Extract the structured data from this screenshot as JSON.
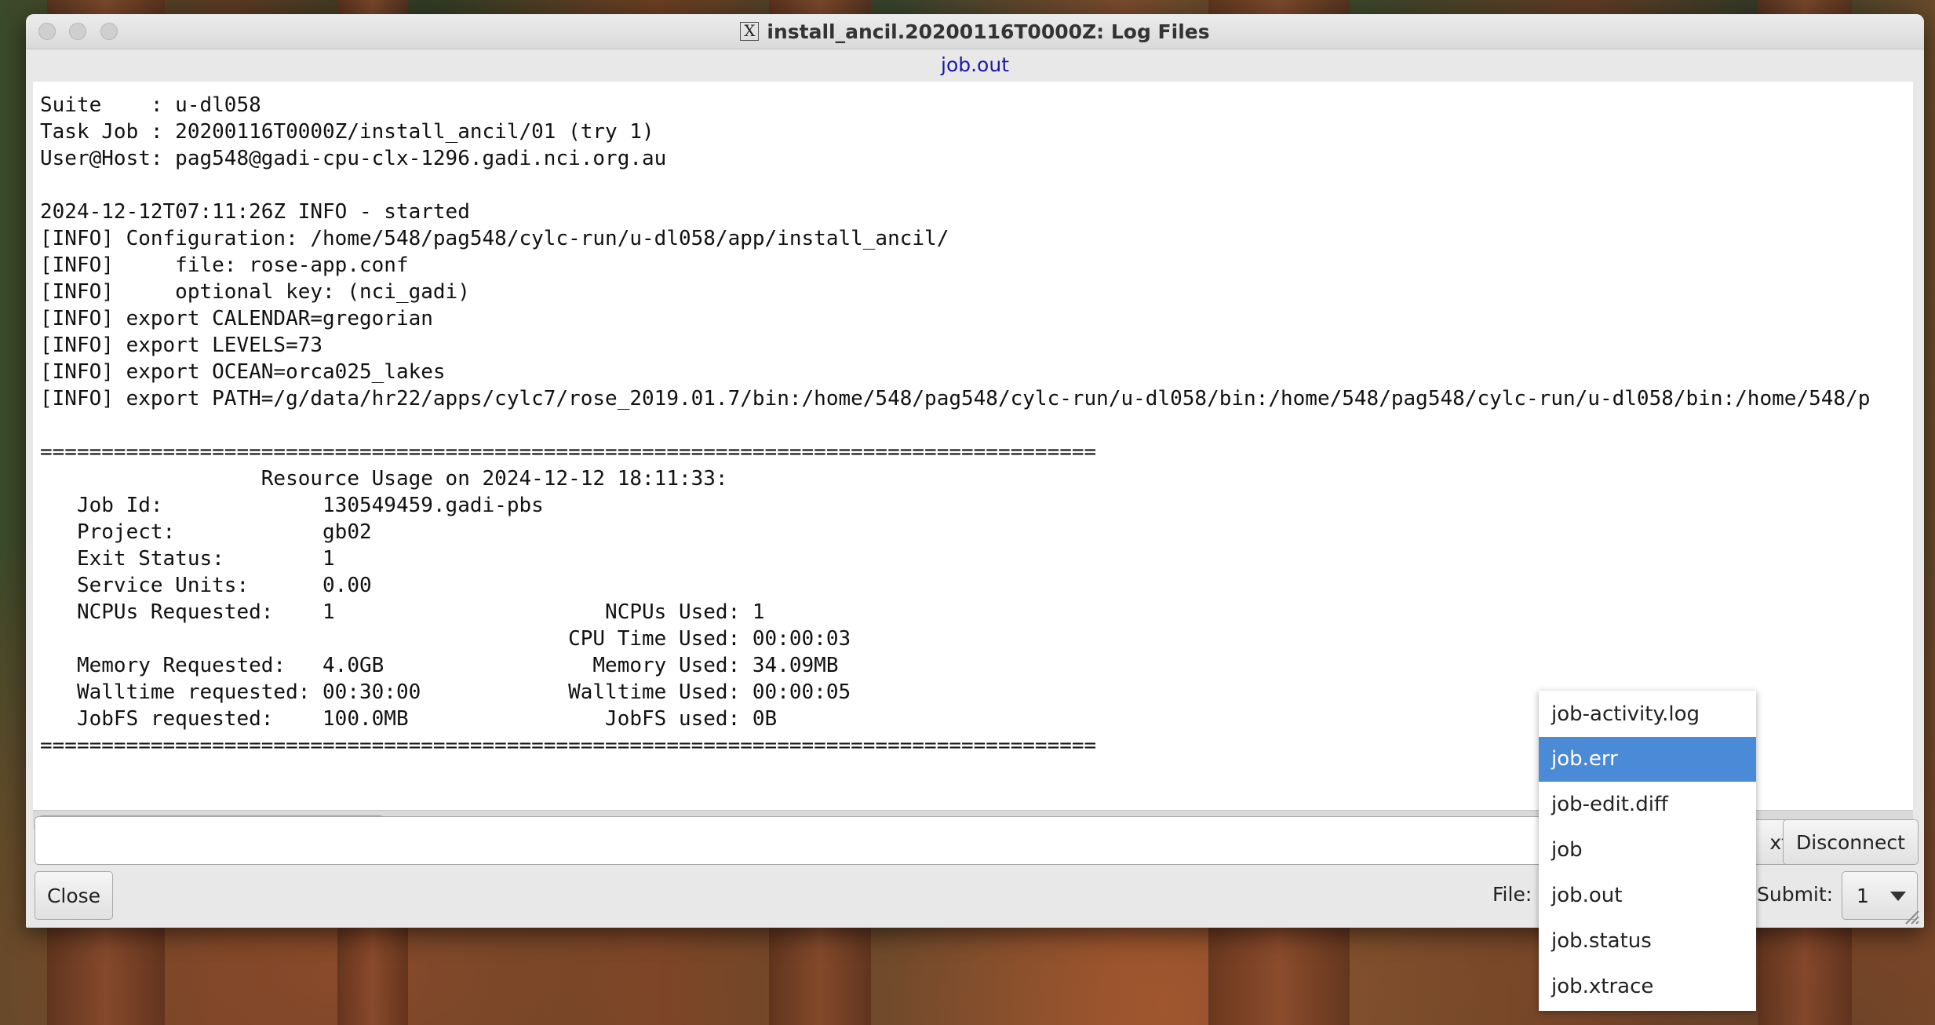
{
  "window": {
    "title": "install_ancil.20200116T0000Z: Log Files",
    "x_icon_glyph": "X",
    "subtitle": "job.out"
  },
  "log": {
    "lines": [
      "Suite    : u-dl058",
      "Task Job : 20200116T0000Z/install_ancil/01 (try 1)",
      "User@Host: pag548@gadi-cpu-clx-1296.gadi.nci.org.au",
      "",
      "2024-12-12T07:11:26Z INFO - started",
      "[INFO] Configuration: /home/548/pag548/cylc-run/u-dl058/app/install_ancil/",
      "[INFO]     file: rose-app.conf",
      "[INFO]     optional key: (nci_gadi)",
      "[INFO] export CALENDAR=gregorian",
      "[INFO] export LEVELS=73",
      "[INFO] export OCEAN=orca025_lakes",
      "[INFO] export PATH=/g/data/hr22/apps/cylc7/rose_2019.01.7/bin:/home/548/pag548/cylc-run/u-dl058/bin:/home/548/pag548/cylc-run/u-dl058/bin:/home/548/p",
      "",
      "======================================================================================",
      "                  Resource Usage on 2024-12-12 18:11:33:",
      "   Job Id:             130549459.gadi-pbs",
      "   Project:            gb02",
      "   Exit Status:        1",
      "   Service Units:      0.00",
      "   NCPUs Requested:    1                      NCPUs Used: 1",
      "                                           CPU Time Used: 00:00:03",
      "   Memory Requested:   4.0GB                 Memory Used: 34.09MB",
      "   Walltime requested: 00:30:00            Walltime Used: 00:00:05",
      "   JobFS requested:    100.0MB                JobFS used: 0B",
      "======================================================================================"
    ]
  },
  "controls": {
    "close_label": "Close",
    "next_partial_label": "xt",
    "disconnect_label": "Disconnect",
    "file_label": "File:",
    "submit_label": "Submit:",
    "submit_value": "1"
  },
  "file_dropdown": {
    "items": [
      "job-activity.log",
      "job.err",
      "job-edit.diff",
      "job",
      "job.out",
      "job.status",
      "job.xtrace"
    ],
    "highlighted": "job.err"
  },
  "colors": {
    "subtitle": "#1a1aa6",
    "highlight": "#4a8ad7"
  }
}
